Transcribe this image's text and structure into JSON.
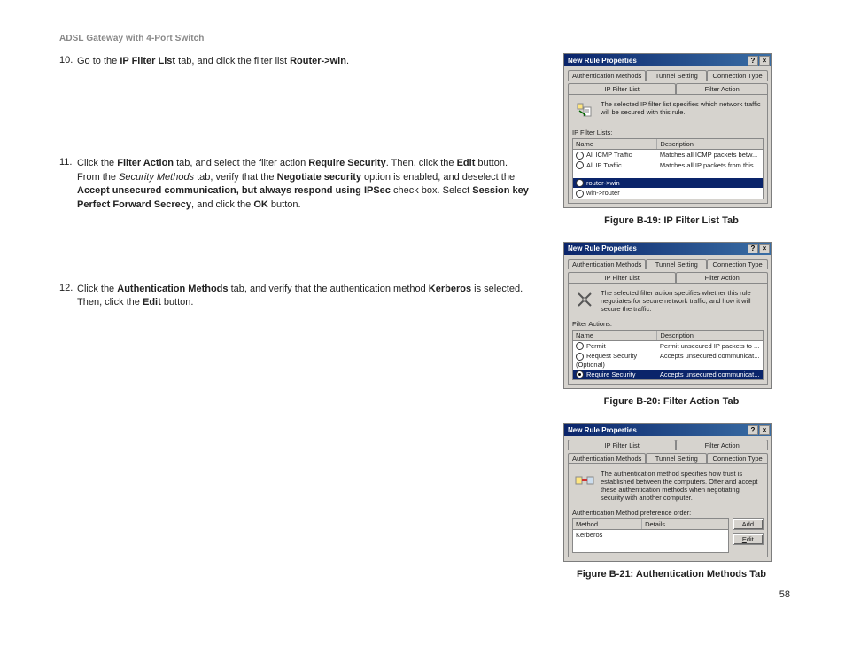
{
  "header": {
    "product": "ADSL Gateway with 4-Port Switch"
  },
  "page_number": "58",
  "steps": [
    {
      "num": "10.",
      "html": "Go to the <b>IP Filter List</b> tab, and click the filter list <b>Router->win</b>."
    },
    {
      "num": "11.",
      "html": "Click the <b>Filter Action</b> tab, and select the filter action <b>Require Security</b>. Then, click the <b>Edit</b> button. From the <i>Security Methods</i> tab, verify that the <b>Negotiate security</b> option is enabled, and deselect the <b>Accept unsecured communication, but always respond using IPSec</b> check box. Select <b>Session key Perfect Forward Secrecy</b>, and click the <b>OK</b> button."
    },
    {
      "num": "12.",
      "html": "Click the <b>Authentication Methods</b> tab, and verify that the authentication method <b>Kerberos</b> is selected. Then, click the <b>Edit</b> button."
    }
  ],
  "figures": {
    "b19": {
      "caption": "Figure B-19: IP Filter List Tab",
      "title": "New Rule Properties",
      "tabs_back": [
        "Authentication Methods",
        "Tunnel Setting",
        "Connection Type"
      ],
      "tabs_front": [
        "IP Filter List",
        "Filter Action"
      ],
      "desc": "The selected IP filter list specifies which network traffic will be secured with this rule.",
      "section": "IP Filter Lists:",
      "cols": [
        "Name",
        "Description"
      ],
      "rows": [
        {
          "name": "All ICMP Traffic",
          "desc": "Matches all ICMP packets betw...",
          "sel": false
        },
        {
          "name": "All IP Traffic",
          "desc": "Matches all IP packets from this ...",
          "sel": false
        },
        {
          "name": "router->win",
          "desc": "",
          "sel": true
        },
        {
          "name": "win->router",
          "desc": "",
          "sel": false
        }
      ]
    },
    "b20": {
      "caption": "Figure B-20: Filter Action Tab",
      "title": "New Rule Properties",
      "tabs_back": [
        "Authentication Methods",
        "Tunnel Setting",
        "Connection Type"
      ],
      "tabs_front": [
        "IP Filter List",
        "Filter Action"
      ],
      "desc": "The selected filter action specifies whether this rule negotiates for secure network traffic, and how it will secure the traffic.",
      "section": "Filter Actions:",
      "cols": [
        "Name",
        "Description"
      ],
      "rows": [
        {
          "name": "Permit",
          "desc": "Permit unsecured IP packets to ...",
          "sel": false
        },
        {
          "name": "Request Security (Optional)",
          "desc": "Accepts unsecured communicat...",
          "sel": false
        },
        {
          "name": "Require Security",
          "desc": "Accepts unsecured communicat...",
          "sel": true,
          "filled": true
        }
      ]
    },
    "b21": {
      "caption": "Figure B-21: Authentication Methods Tab",
      "title": "New Rule Properties",
      "tabs_back": [
        "IP Filter List",
        "Filter Action"
      ],
      "tabs_front": [
        "Authentication Methods",
        "Tunnel Setting",
        "Connection Type"
      ],
      "desc": "The authentication method specifies how trust is established between the computers. Offer and accept these authentication methods when negotiating security with another computer.",
      "section": "Authentication Method preference order:",
      "cols": [
        "Method",
        "Details"
      ],
      "rows": [
        {
          "name": "Kerberos",
          "desc": ""
        }
      ],
      "buttons": [
        "Add",
        "Edit"
      ]
    }
  }
}
